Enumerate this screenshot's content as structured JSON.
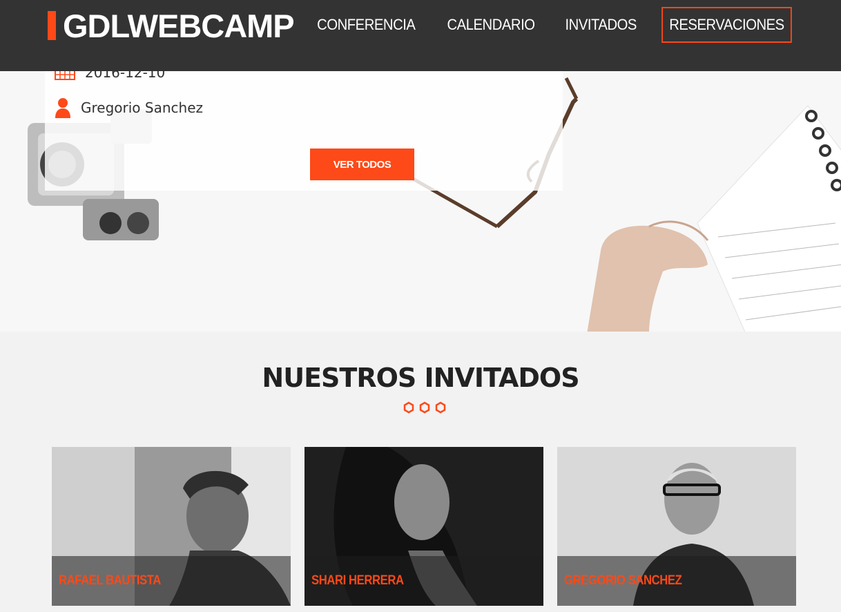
{
  "brand": {
    "logo_text": "GDLWEBCAMP",
    "accent": "#fe4918",
    "header_bg": "#333333"
  },
  "nav": {
    "items": [
      {
        "label": "CONFERENCIA"
      },
      {
        "label": "CALENDARIO"
      },
      {
        "label": "INVITADOS"
      },
      {
        "label": "RESERVACIONES"
      }
    ]
  },
  "event": {
    "date": "2016-12-10",
    "host": "Gregorio Sanchez",
    "date_icon": "calendar-icon",
    "host_icon": "user-icon",
    "button_label": "VER TODOS"
  },
  "invitados": {
    "title": "NUESTROS INVITADOS",
    "guests": [
      {
        "name": "RAFAEL BAUTISTA"
      },
      {
        "name": "SHARI HERRERA"
      },
      {
        "name": "GREGORIO SANCHEZ"
      }
    ]
  }
}
